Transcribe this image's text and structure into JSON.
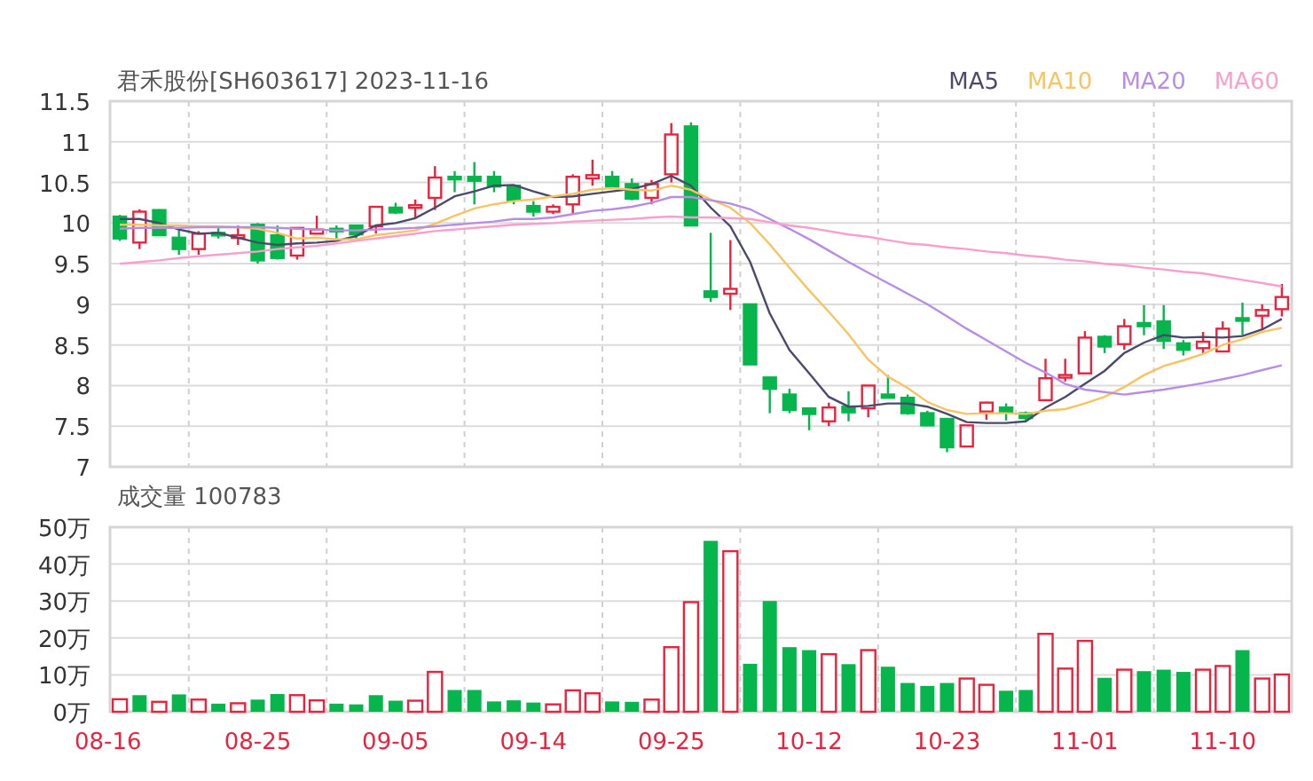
{
  "price_chart": {
    "title": "君禾股份[SH603617] 2023-11-16",
    "candles": {
      "chart_data": {
        "type": "candlestick",
        "grid": true,
        "ylim": [
          7,
          11.5
        ],
        "yticks": [
          7,
          7.5,
          8,
          8.5,
          9,
          9.5,
          10,
          10.5,
          11,
          11.5
        ],
        "ohlc": [
          [
            10.08,
            10.1,
            9.78,
            9.81
          ],
          [
            9.76,
            10.17,
            9.68,
            10.14
          ],
          [
            10.16,
            10.17,
            9.84,
            9.85
          ],
          [
            9.82,
            9.94,
            9.61,
            9.68
          ],
          [
            9.68,
            9.9,
            9.61,
            9.87
          ],
          [
            9.88,
            9.97,
            9.81,
            9.85
          ],
          [
            9.84,
            9.97,
            9.73,
            9.85
          ],
          [
            9.98,
            10.0,
            9.5,
            9.54
          ],
          [
            9.85,
            9.97,
            9.55,
            9.57
          ],
          [
            9.6,
            9.94,
            9.55,
            9.94
          ],
          [
            9.87,
            10.09,
            9.86,
            9.92
          ],
          [
            9.93,
            9.97,
            9.81,
            9.91
          ],
          [
            9.97,
            9.97,
            9.81,
            9.86
          ],
          [
            9.96,
            10.2,
            9.87,
            10.2
          ],
          [
            10.19,
            10.25,
            10.11,
            10.13
          ],
          [
            10.2,
            10.29,
            10.06,
            10.22
          ],
          [
            10.31,
            10.7,
            10.16,
            10.56
          ],
          [
            10.57,
            10.64,
            10.38,
            10.54
          ],
          [
            10.57,
            10.75,
            10.23,
            10.52
          ],
          [
            10.57,
            10.64,
            10.38,
            10.45
          ],
          [
            10.46,
            10.46,
            10.23,
            10.28
          ],
          [
            10.21,
            10.27,
            10.08,
            10.14
          ],
          [
            10.14,
            10.23,
            10.11,
            10.2
          ],
          [
            10.23,
            10.6,
            10.11,
            10.57
          ],
          [
            10.55,
            10.78,
            10.46,
            10.59
          ],
          [
            10.57,
            10.64,
            10.45,
            10.45
          ],
          [
            10.48,
            10.55,
            10.28,
            10.3
          ],
          [
            10.31,
            10.53,
            10.23,
            10.48
          ],
          [
            10.6,
            11.23,
            10.5,
            11.09
          ],
          [
            11.19,
            11.24,
            9.97,
            9.97
          ],
          [
            9.16,
            9.88,
            9.03,
            9.09
          ],
          [
            9.13,
            9.79,
            8.93,
            9.19
          ],
          [
            9.0,
            9.0,
            8.26,
            8.26
          ],
          [
            8.1,
            8.1,
            7.66,
            7.96
          ],
          [
            7.89,
            7.96,
            7.66,
            7.7
          ],
          [
            7.72,
            7.72,
            7.45,
            7.65
          ],
          [
            7.56,
            7.79,
            7.5,
            7.73
          ],
          [
            7.74,
            7.93,
            7.56,
            7.67
          ],
          [
            7.72,
            8.0,
            7.61,
            8.0
          ],
          [
            7.89,
            8.13,
            7.84,
            7.85
          ],
          [
            7.85,
            7.89,
            7.64,
            7.66
          ],
          [
            7.66,
            7.69,
            7.5,
            7.51
          ],
          [
            7.59,
            7.59,
            7.18,
            7.24
          ],
          [
            7.25,
            7.51,
            7.25,
            7.51
          ],
          [
            7.68,
            7.8,
            7.58,
            7.79
          ],
          [
            7.73,
            7.78,
            7.57,
            7.67
          ],
          [
            7.66,
            7.68,
            7.56,
            7.6
          ],
          [
            7.82,
            8.33,
            7.82,
            8.09
          ],
          [
            8.11,
            8.33,
            8.05,
            8.13
          ],
          [
            8.15,
            8.67,
            8.15,
            8.59
          ],
          [
            8.6,
            8.62,
            8.4,
            8.48
          ],
          [
            8.51,
            8.82,
            8.44,
            8.73
          ],
          [
            8.77,
            8.99,
            8.62,
            8.73
          ],
          [
            8.79,
            8.99,
            8.45,
            8.55
          ],
          [
            8.52,
            8.56,
            8.37,
            8.44
          ],
          [
            8.46,
            8.66,
            8.4,
            8.54
          ],
          [
            8.42,
            8.79,
            8.42,
            8.7
          ],
          [
            8.83,
            9.02,
            8.62,
            8.82
          ],
          [
            8.86,
            9.0,
            8.7,
            8.93
          ],
          [
            8.94,
            9.25,
            8.85,
            9.09
          ]
        ]
      }
    },
    "moving_averages": {
      "chart_data": {
        "type": "line",
        "ylim": [
          7,
          11.5
        ],
        "series": [
          {
            "name": "MA5",
            "color": "#4b4a6b",
            "values": [
              10.05,
              10.05,
              10.0,
              9.92,
              9.87,
              9.88,
              9.82,
              9.76,
              9.73,
              9.75,
              9.76,
              9.78,
              9.84,
              9.97,
              10.0,
              10.06,
              10.19,
              10.33,
              10.39,
              10.46,
              10.47,
              10.39,
              10.32,
              10.33,
              10.36,
              10.39,
              10.42,
              10.48,
              10.58,
              10.46,
              10.19,
              9.96,
              9.52,
              8.89,
              8.44,
              8.15,
              7.86,
              7.74,
              7.75,
              7.78,
              7.78,
              7.74,
              7.65,
              7.55,
              7.54,
              7.54,
              7.56,
              7.73,
              7.86,
              8.02,
              8.18,
              8.4,
              8.53,
              8.62,
              8.59,
              8.6,
              8.59,
              8.61,
              8.69,
              8.82
            ]
          },
          {
            "name": "MA10",
            "color": "#f7c463",
            "values": [
              9.98,
              9.98,
              9.97,
              9.97,
              9.96,
              9.96,
              9.95,
              9.93,
              9.88,
              9.81,
              9.82,
              9.8,
              9.8,
              9.85,
              9.88,
              9.91,
              9.99,
              10.09,
              10.18,
              10.23,
              10.27,
              10.29,
              10.33,
              10.36,
              10.41,
              10.43,
              10.41,
              10.4,
              10.46,
              10.41,
              10.29,
              10.19,
              10.0,
              9.74,
              9.45,
              9.17,
              8.91,
              8.63,
              8.32,
              8.11,
              7.97,
              7.8,
              7.7,
              7.65,
              7.66,
              7.66,
              7.65,
              7.69,
              7.71,
              7.78,
              7.86,
              7.98,
              8.13,
              8.24,
              8.31,
              8.39,
              8.5,
              8.57,
              8.66,
              8.71
            ]
          },
          {
            "name": "MA20",
            "color": "#b78ee3",
            "values": [
              9.93,
              9.94,
              9.94,
              9.94,
              9.95,
              9.95,
              9.95,
              9.95,
              9.94,
              9.93,
              9.92,
              9.91,
              9.91,
              9.92,
              9.93,
              9.94,
              9.96,
              9.98,
              10.0,
              10.02,
              10.05,
              10.05,
              10.07,
              10.11,
              10.15,
              10.17,
              10.2,
              10.25,
              10.32,
              10.32,
              10.28,
              10.24,
              10.17,
              10.05,
              9.93,
              9.8,
              9.66,
              9.52,
              9.39,
              9.26,
              9.13,
              9.0,
              8.85,
              8.7,
              8.56,
              8.42,
              8.28,
              8.16,
              8.02,
              7.95,
              7.92,
              7.89,
              7.92,
              7.95,
              7.99,
              8.03,
              8.08,
              8.13,
              8.19,
              8.25
            ]
          },
          {
            "name": "MA60",
            "color": "#f7a0cd",
            "values": [
              9.5,
              9.52,
              9.54,
              9.57,
              9.59,
              9.61,
              9.63,
              9.65,
              9.68,
              9.7,
              9.72,
              9.75,
              9.78,
              9.81,
              9.84,
              9.87,
              9.9,
              9.92,
              9.94,
              9.96,
              9.98,
              9.99,
              10.0,
              10.02,
              10.03,
              10.04,
              10.05,
              10.07,
              10.08,
              10.07,
              10.07,
              10.06,
              10.05,
              10.01,
              9.97,
              9.94,
              9.9,
              9.86,
              9.83,
              9.79,
              9.75,
              9.73,
              9.7,
              9.68,
              9.65,
              9.63,
              9.6,
              9.58,
              9.55,
              9.53,
              9.5,
              9.48,
              9.45,
              9.43,
              9.4,
              9.38,
              9.34,
              9.3,
              9.26,
              9.22
            ]
          }
        ]
      }
    }
  },
  "volume_chart": {
    "title": "成交量 100783",
    "chart_data": {
      "type": "bar",
      "stacked": true,
      "grid": true,
      "categories": [
        "08-16",
        null,
        null,
        null,
        null,
        null,
        null,
        "08-25",
        null,
        null,
        null,
        null,
        null,
        null,
        "09-05",
        null,
        null,
        null,
        null,
        null,
        null,
        "09-14",
        null,
        null,
        null,
        null,
        null,
        null,
        "09-25",
        null,
        null,
        null,
        null,
        null,
        null,
        "10-12",
        null,
        null,
        null,
        null,
        null,
        null,
        "10-23",
        null,
        null,
        null,
        null,
        null,
        null,
        "11-01",
        null,
        null,
        null,
        null,
        null,
        null,
        "11-10",
        null,
        null,
        null
      ],
      "ylim": [
        0,
        50
      ],
      "yticks": [
        {
          "value": 0,
          "label": "0万"
        },
        {
          "value": 10,
          "label": "10万"
        },
        {
          "value": 20,
          "label": "20万"
        },
        {
          "value": 30,
          "label": "30万"
        },
        {
          "value": 40,
          "label": "40万"
        },
        {
          "value": 50,
          "label": "50万"
        }
      ],
      "series": [
        {
          "color": "#e5243f",
          "values": [
            3.4,
            null,
            2.7,
            null,
            3.3,
            null,
            2.3,
            null,
            null,
            4.5,
            3.1,
            null,
            null,
            null,
            null,
            3.0,
            10.8,
            null,
            null,
            null,
            null,
            null,
            2.0,
            5.8,
            5.0,
            null,
            null,
            3.3,
            17.5,
            29.7,
            null,
            43.5,
            null,
            null,
            null,
            null,
            15.6,
            null,
            16.7,
            null,
            null,
            null,
            null,
            9.0,
            7.3,
            null,
            null,
            21.1,
            11.7,
            19.2,
            null,
            11.4,
            null,
            null,
            null,
            11.4,
            12.4,
            null,
            9.0,
            10.1
          ]
        },
        {
          "color": "#06b54c",
          "values": [
            null,
            4.5,
            null,
            4.7,
            null,
            2.2,
            null,
            3.3,
            4.8,
            null,
            null,
            2.2,
            2.0,
            4.5,
            3.0,
            null,
            null,
            5.9,
            5.9,
            2.8,
            3.1,
            2.5,
            null,
            null,
            null,
            2.8,
            2.7,
            null,
            null,
            null,
            46.3,
            null,
            13.0,
            30.0,
            17.5,
            16.7,
            null,
            12.9,
            null,
            12.2,
            7.8,
            7.0,
            7.8,
            null,
            null,
            5.7,
            5.9,
            null,
            null,
            null,
            9.2,
            null,
            11.0,
            11.4,
            10.8,
            null,
            null,
            16.7,
            null,
            null
          ]
        }
      ]
    }
  }
}
